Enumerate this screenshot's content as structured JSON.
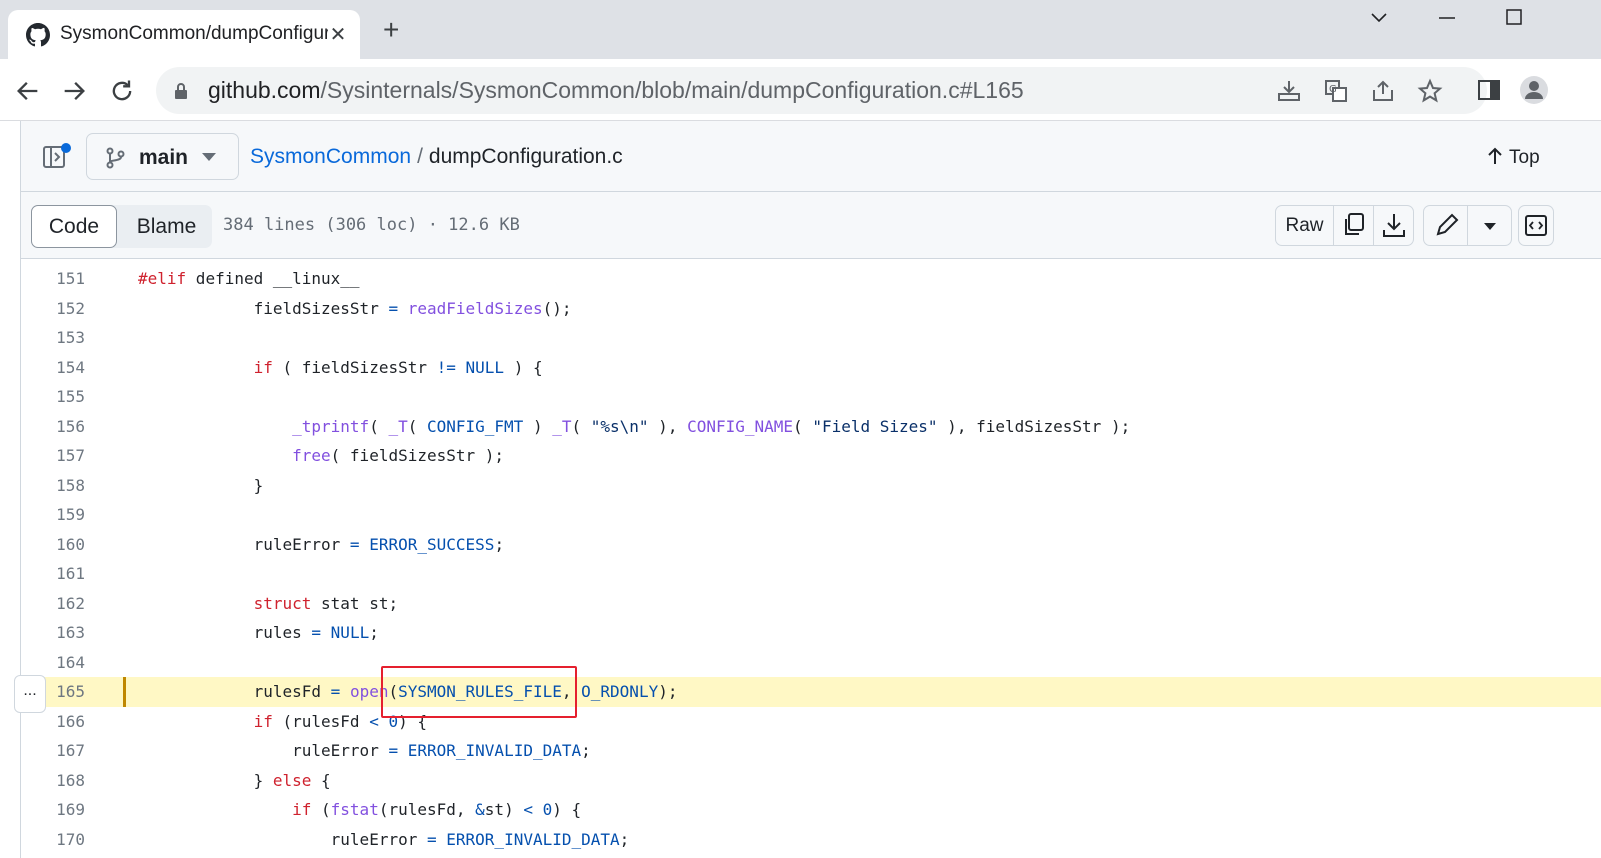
{
  "browser": {
    "tab_title": "SysmonCommon/dumpConfiguration.c",
    "url_host": "github.com",
    "url_path": "/Sysinternals/SysmonCommon/blob/main/dumpConfiguration.c#L165"
  },
  "repo_header": {
    "branch": "main",
    "repo": "SysmonCommon",
    "separator": "/",
    "file": "dumpConfiguration.c",
    "top_label": "Top"
  },
  "code_header": {
    "code_tab": "Code",
    "blame_tab": "Blame",
    "meta": "384 lines (306 loc) · 12.6 KB",
    "raw_label": "Raw"
  },
  "highlighted_line": 165,
  "expand_label": "...",
  "lines": [
    {
      "n": "151",
      "code": "#elif defined __linux__"
    },
    {
      "n": "152",
      "code": "            fieldSizesStr = readFieldSizes();"
    },
    {
      "n": "153",
      "code": ""
    },
    {
      "n": "154",
      "code": "            if ( fieldSizesStr != NULL ) {"
    },
    {
      "n": "155",
      "code": ""
    },
    {
      "n": "156",
      "code": "                _tprintf( _T( CONFIG_FMT ) _T( \"%s\\n\" ), CONFIG_NAME( \"Field Sizes\" ), fieldSizesStr );"
    },
    {
      "n": "157",
      "code": "                free( fieldSizesStr );"
    },
    {
      "n": "158",
      "code": "            }"
    },
    {
      "n": "159",
      "code": ""
    },
    {
      "n": "160",
      "code": "            ruleError = ERROR_SUCCESS;"
    },
    {
      "n": "161",
      "code": ""
    },
    {
      "n": "162",
      "code": "            struct stat st;"
    },
    {
      "n": "163",
      "code": "            rules = NULL;"
    },
    {
      "n": "164",
      "code": ""
    },
    {
      "n": "165",
      "code": "            rulesFd = open(SYSMON_RULES_FILE, O_RDONLY);"
    },
    {
      "n": "166",
      "code": "            if (rulesFd < 0) {"
    },
    {
      "n": "167",
      "code": "                ruleError = ERROR_INVALID_DATA;"
    },
    {
      "n": "168",
      "code": "            } else {"
    },
    {
      "n": "169",
      "code": "                if (fstat(rulesFd, &st) < 0) {"
    },
    {
      "n": "170",
      "code": "                    ruleError = ERROR_INVALID_DATA;"
    }
  ]
}
